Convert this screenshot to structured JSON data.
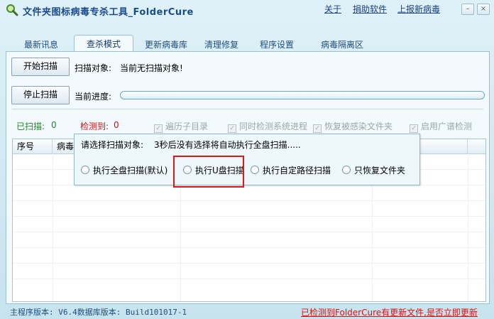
{
  "window": {
    "title": "文件夹图标病毒专杀工具_FolderCure",
    "links": [
      "关于",
      "捐助软件",
      "上报新病毒"
    ],
    "controls": {
      "minimize": "–",
      "close": "×"
    }
  },
  "tabs": [
    "最新讯息",
    "查杀模式",
    "更新病毒库",
    "清理修复",
    "程序设置",
    "病毒隔离区"
  ],
  "active_tab": "查杀模式",
  "scan": {
    "start_button": "开始扫描",
    "target_label": "扫描对象:",
    "target_value": "当前无扫描对象!",
    "stop_button": "停止扫描",
    "progress_label": "当前进度:",
    "progress_value": 0
  },
  "stats": {
    "scanned_label": "已扫描:",
    "scanned_value": "0",
    "detected_label": "检测到:",
    "detected_value": "0"
  },
  "options": [
    {
      "label": "遍历子目录",
      "checked": true
    },
    {
      "label": "同时检测系统进程",
      "checked": true
    },
    {
      "label": "恢复被感染文件夹",
      "checked": true
    },
    {
      "label": "启用广谱检测",
      "checked": true
    }
  ],
  "table": {
    "columns": [
      "序号",
      "病毒名"
    ]
  },
  "popup": {
    "prompt": "请选择扫描对象:",
    "countdown": "3秒后没有选择将自动执行全盘扫描.....",
    "choices": [
      "执行全盘扫描(默认)",
      "执行U盘扫描",
      "执行自定路径扫描",
      "只恢复文件夹"
    ],
    "highlighted_choice": "执行U盘扫描"
  },
  "status": {
    "version_text": "主程序版本: V6.4数据库版本: Build101017-1",
    "update_notice": "已检测到FolderCure有更新文件,是否立即更新"
  },
  "colors": {
    "accent": "#1a4b8c",
    "scanned": "#1a8c1a",
    "detected": "#d01010",
    "highlight": "#e01515"
  }
}
